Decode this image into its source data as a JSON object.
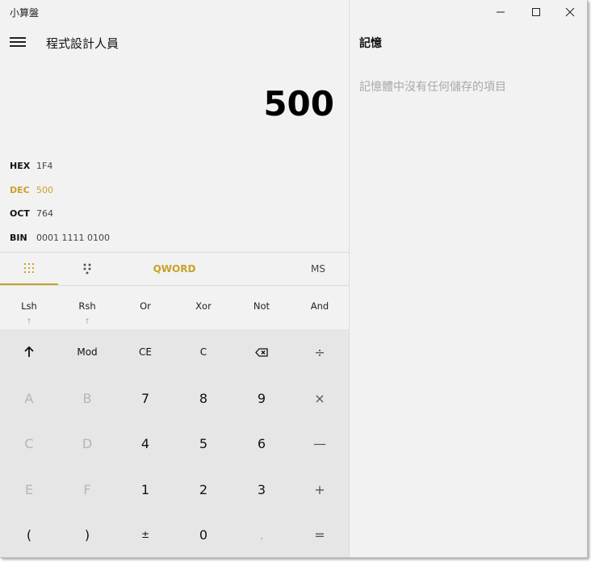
{
  "window": {
    "title": "小算盤"
  },
  "header": {
    "mode_title": "程式設計人員"
  },
  "display": {
    "value": "500"
  },
  "radix": [
    {
      "label": "HEX",
      "value": "1F4",
      "active": false
    },
    {
      "label": "DEC",
      "value": "500",
      "active": true
    },
    {
      "label": "OCT",
      "value": "764",
      "active": false
    },
    {
      "label": "BIN",
      "value": "0001 1111 0100",
      "active": false
    }
  ],
  "tabs": {
    "word_size": "QWORD",
    "memory_store": "MS"
  },
  "bitops": [
    {
      "label": "Lsh",
      "arrow": "↑"
    },
    {
      "label": "Rsh",
      "arrow": "↑"
    },
    {
      "label": "Or",
      "arrow": ""
    },
    {
      "label": "Xor",
      "arrow": ""
    },
    {
      "label": "Not",
      "arrow": ""
    },
    {
      "label": "And",
      "arrow": ""
    }
  ],
  "keys": [
    [
      "",
      "Mod",
      "CE",
      "C",
      "",
      "÷"
    ],
    [
      "A",
      "B",
      "7",
      "8",
      "9",
      "×"
    ],
    [
      "C",
      "D",
      "4",
      "5",
      "6",
      "—"
    ],
    [
      "E",
      "F",
      "1",
      "2",
      "3",
      "+"
    ],
    [
      "(",
      ")",
      "±",
      "0",
      ".",
      "="
    ]
  ],
  "memory": {
    "title": "記憶",
    "empty_message": "記憶體中沒有任何儲存的項目"
  },
  "colors": {
    "accent": "#c9a227",
    "keypad_bg": "#e6e6e6",
    "panel_bg": "#f2f2f2"
  }
}
